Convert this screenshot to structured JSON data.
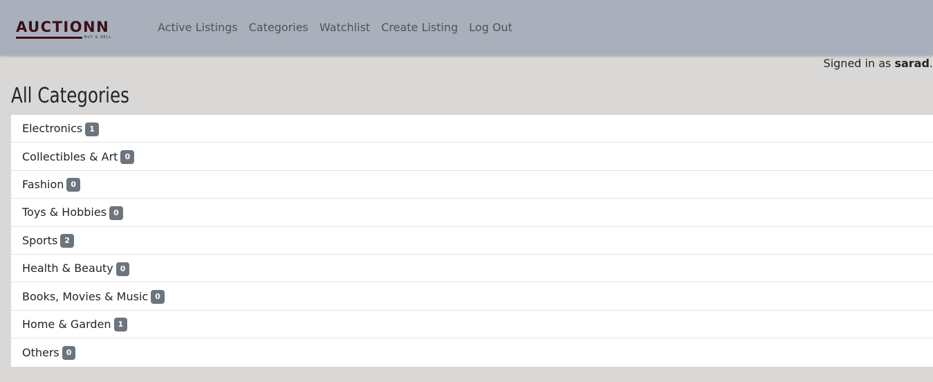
{
  "brand": {
    "name": "AUCTIONN",
    "tagline": "BUY & SELL"
  },
  "nav": {
    "items": [
      {
        "label": "Active Listings"
      },
      {
        "label": "Categories"
      },
      {
        "label": "Watchlist"
      },
      {
        "label": "Create Listing"
      },
      {
        "label": "Log Out"
      }
    ]
  },
  "user": {
    "signed_in_prefix": "Signed in as",
    "username": "sarad",
    "suffix": "."
  },
  "page": {
    "title": "All Categories"
  },
  "categories": [
    {
      "name": "Electronics",
      "count": "1"
    },
    {
      "name": "Collectibles & Art",
      "count": "0"
    },
    {
      "name": "Fashion",
      "count": "0"
    },
    {
      "name": "Toys & Hobbies",
      "count": "0"
    },
    {
      "name": "Sports",
      "count": "2"
    },
    {
      "name": "Health & Beauty",
      "count": "0"
    },
    {
      "name": "Books, Movies & Music",
      "count": "0"
    },
    {
      "name": "Home & Garden",
      "count": "1"
    },
    {
      "name": "Others",
      "count": "0"
    }
  ],
  "colors": {
    "navbar_bg": "#a9b0bb",
    "page_bg": "#d9d8d6",
    "logo": "#3a1016",
    "badge_bg": "#6c757d"
  }
}
